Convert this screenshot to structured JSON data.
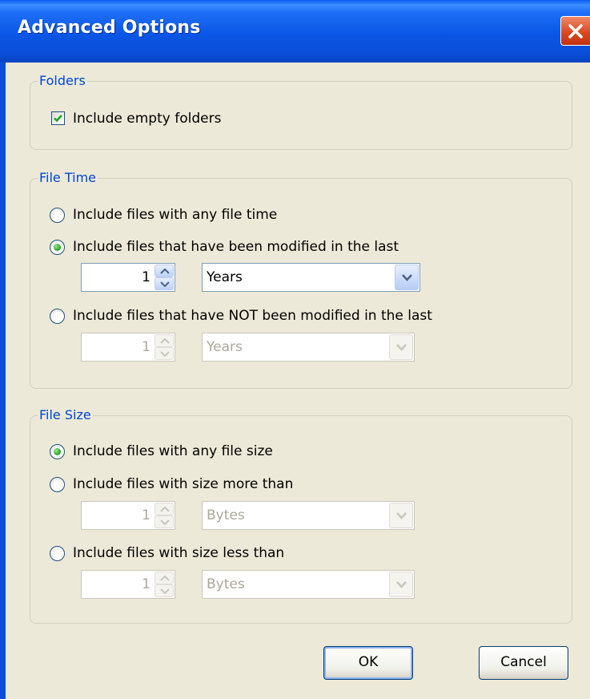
{
  "window": {
    "title": "Advanced Options"
  },
  "folders": {
    "legend": "Folders",
    "include_empty_label": "Include empty folders",
    "include_empty_checked": true
  },
  "file_time": {
    "legend": "File Time",
    "option_any": "Include files with any file time",
    "option_modified": "Include files that have been modified in the last",
    "option_not_modified": "Include files that have NOT been modified in the last",
    "selected": "modified",
    "modified_value": "1",
    "modified_unit": "Years",
    "not_modified_value": "1",
    "not_modified_unit": "Years"
  },
  "file_size": {
    "legend": "File Size",
    "option_any": "Include files with any file size",
    "option_more": "Include files with size more than",
    "option_less": "Include files with size less than",
    "selected": "any",
    "more_value": "1",
    "more_unit": "Bytes",
    "less_value": "1",
    "less_unit": "Bytes"
  },
  "buttons": {
    "ok": "OK",
    "cancel": "Cancel"
  },
  "icons": [
    "close-icon",
    "checkmark-icon",
    "spin-up-icon",
    "spin-down-icon",
    "dropdown-arrow-icon"
  ],
  "colors": {
    "titlebar": "#0a56e6",
    "legend_text": "#0046d5",
    "dialog_bg": "#ece9d8",
    "radio_dot": "#21a121"
  }
}
